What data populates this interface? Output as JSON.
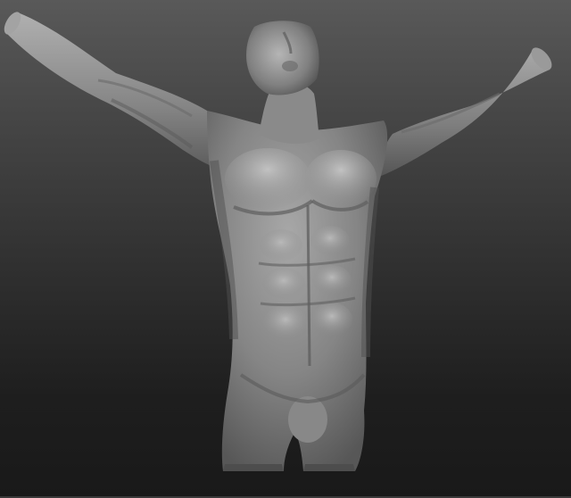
{
  "viewport": {
    "model": "sculpt-torso-figure",
    "material_colors": {
      "base": "#8e8e8e",
      "highlight": "#c4c4c4",
      "shadow": "#3e3e3e"
    },
    "background": {
      "top": "#595959",
      "bottom": "#191919"
    }
  }
}
